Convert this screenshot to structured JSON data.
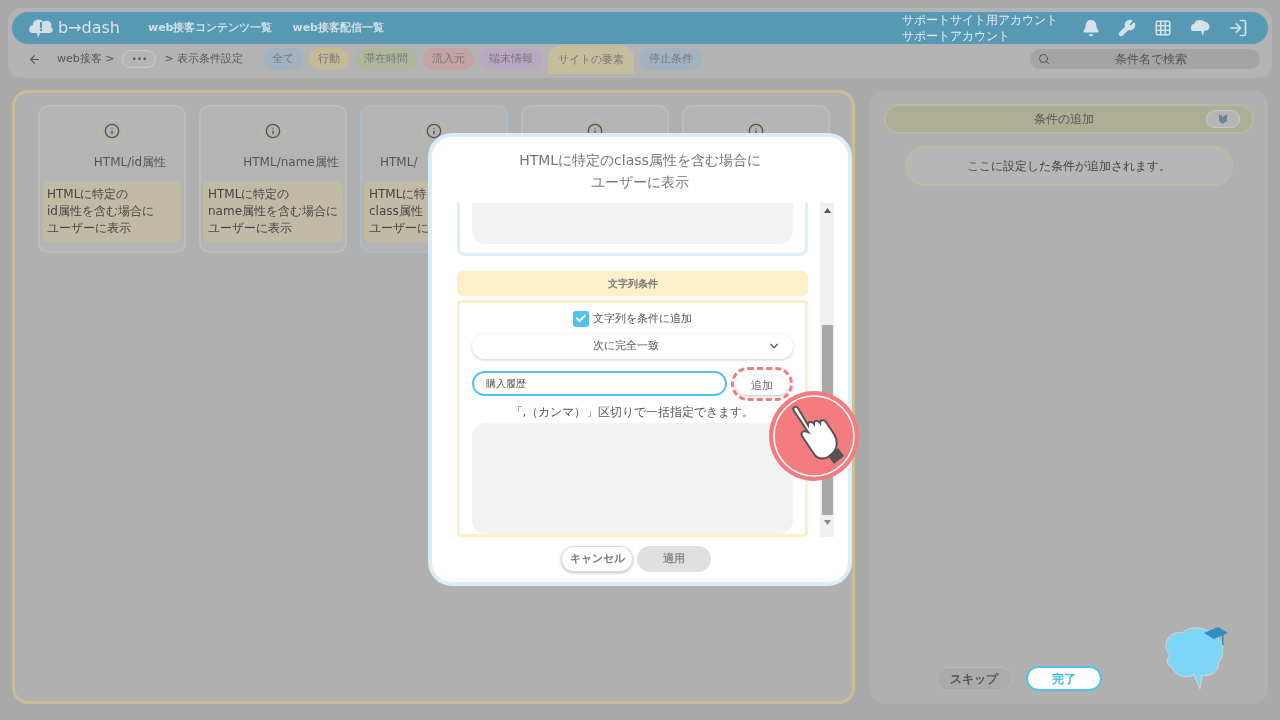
{
  "header": {
    "logo": "b→dash",
    "nav": [
      "web接客コンテンツ一覧",
      "web接客配信一覧"
    ],
    "account": [
      "サポートサイト用アカウント",
      "サポートアカウント"
    ]
  },
  "breadcrumb": {
    "first": "web接客 >",
    "more": "•••",
    "last": "> 表示条件設定"
  },
  "filters": [
    {
      "label": "全て",
      "color": "#a3b2c0",
      "selected": false
    },
    {
      "label": "行動",
      "color": "#c4ba95",
      "selected": false
    },
    {
      "label": "滞在時間",
      "color": "#aeb69e",
      "selected": false
    },
    {
      "label": "流入元",
      "color": "#c6a3a3",
      "selected": false
    },
    {
      "label": "端末情報",
      "color": "#b9a8c2",
      "selected": false
    },
    {
      "label": "サイトの要素",
      "color": "#c6bd9c",
      "selected": true
    },
    {
      "label": "停止条件",
      "color": "#a3b2c0",
      "selected": false
    }
  ],
  "search": {
    "placeholder": "条件名で検索"
  },
  "cards": [
    {
      "title": "HTML/id属性",
      "description": [
        "HTMLに特定の",
        "id属性を含む場合に",
        "ユーザーに表示"
      ],
      "selected": false
    },
    {
      "title": "HTML/name属性",
      "description": [
        "HTMLに特定の",
        "name属性を含む場合に",
        "ユーザーに表示"
      ],
      "selected": false
    },
    {
      "title": "HTML/",
      "description": [
        "HTMLに特",
        "class属性",
        "ユーザーに"
      ],
      "selected": true
    },
    {
      "selected": false
    },
    {
      "selected": false
    }
  ],
  "modal": {
    "title": [
      "HTMLに特定のclass属性を含む場合に",
      "ユーザーに表示"
    ],
    "section": "文字列条件",
    "checkbox": {
      "label": "文字列を条件に追加",
      "checked": true
    },
    "match": "次に完全一致",
    "input": "購入履歴",
    "add_button": "追加",
    "hint": "「,（カンマ）」区切りで一括指定できます。",
    "buttons": [
      {
        "label": "キャンセル",
        "disabled": false
      },
      {
        "label": "適用",
        "disabled": true
      }
    ]
  },
  "panel": {
    "title": "条件の追加",
    "message": "ここに設定した条件が追加されます。",
    "skip": "スキップ",
    "done": "完了"
  }
}
